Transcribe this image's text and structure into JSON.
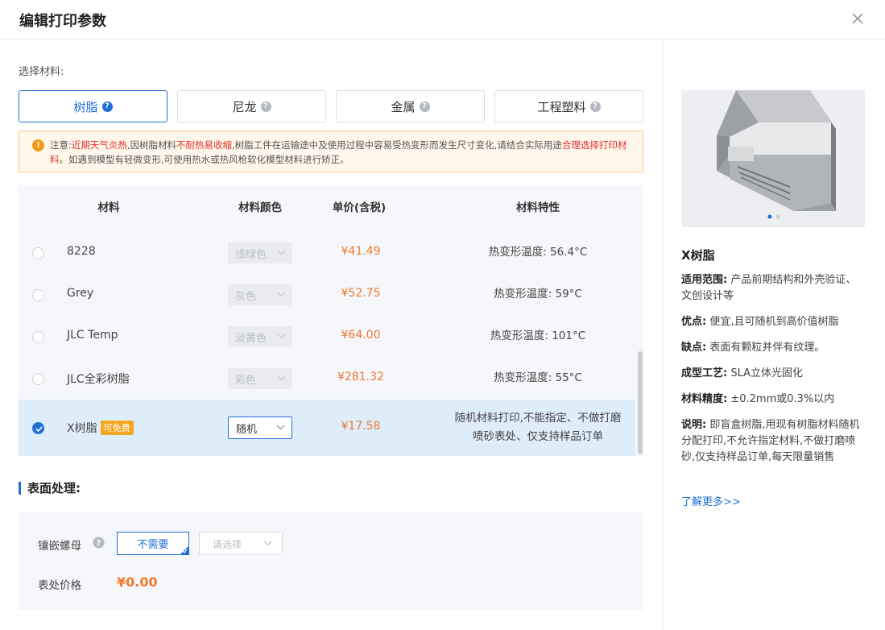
{
  "dialog": {
    "title": "编辑打印参数"
  },
  "material": {
    "select_label": "选择材料:",
    "tabs": [
      {
        "label": "树脂",
        "active": true
      },
      {
        "label": "尼龙",
        "active": false
      },
      {
        "label": "金属",
        "active": false
      },
      {
        "label": "工程塑料",
        "active": false
      }
    ]
  },
  "notice": {
    "prefix": "注意:",
    "red1": "近期天气炎热",
    "text1": ",因树脂材料",
    "red2": "不耐热易收缩",
    "text2": ",树脂工件在运输途中及使用过程中容易受热变形而发生尺寸变化,请结合实际用途",
    "red3": "合理选择打印材料",
    "text3": "。如遇到模型有轻微变形,可使用热水或热风枪软化模型材料进行矫正。"
  },
  "table": {
    "headers": {
      "material": "材料",
      "color": "材料颜色",
      "price": "单价(含税)",
      "feature": "材料特性"
    },
    "rows": [
      {
        "name": "8228",
        "color": "浅绿色",
        "price": "¥41.49",
        "feature": "热变形温度: 56.4°C",
        "selected": false
      },
      {
        "name": "Grey",
        "color": "灰色",
        "price": "¥52.75",
        "feature": "热变形温度:  59°C",
        "selected": false
      },
      {
        "name": "JLC Temp",
        "color": "淡黄色",
        "price": "¥64.00",
        "feature": "热变形温度:  101°C",
        "selected": false
      },
      {
        "name": "JLC全彩树脂",
        "color": "彩色",
        "price": "¥281.32",
        "feature": "热变形温度: 55°C",
        "selected": false
      },
      {
        "name": "X树脂",
        "badge": "可免费",
        "color": "随机",
        "price": "¥17.58",
        "feature_line1": "随机材料打印,不能指定、不做打磨",
        "feature_line2": "喷砂表处、仅支持样品订单",
        "selected": true
      }
    ]
  },
  "surface": {
    "title": "表面处理:",
    "nut_label": "镶嵌螺母",
    "none_button": "不需要",
    "select_placeholder": "请选择",
    "price_label": "表处价格",
    "price_value": "¥0.00"
  },
  "info": {
    "title": "X树脂",
    "scope_label": "适用范围:",
    "scope_text": "产品前期结构和外壳验证、文创设计等",
    "pros_label": "优点:",
    "pros_text": "便宜,且可随机到高价值树脂",
    "cons_label": "缺点:",
    "cons_text": "表面有颗粒并伴有纹理。",
    "process_label": "成型工艺:",
    "process_text": "SLA立体光固化",
    "precision_label": "材料精度:",
    "precision_text": "±0.2mm或0.3%以内",
    "note_label": "说明:",
    "note_text": "即盲盒树脂,用现有树脂材料随机分配打印,不允许指定材料,不做打磨喷砂,仅支持样品订单,每天限量销售",
    "more_link": "了解更多>>"
  },
  "colors": {
    "accent": "#1f6fd6",
    "price": "#f0792e",
    "warn": "#f39a1c",
    "red": "#e0312e"
  }
}
